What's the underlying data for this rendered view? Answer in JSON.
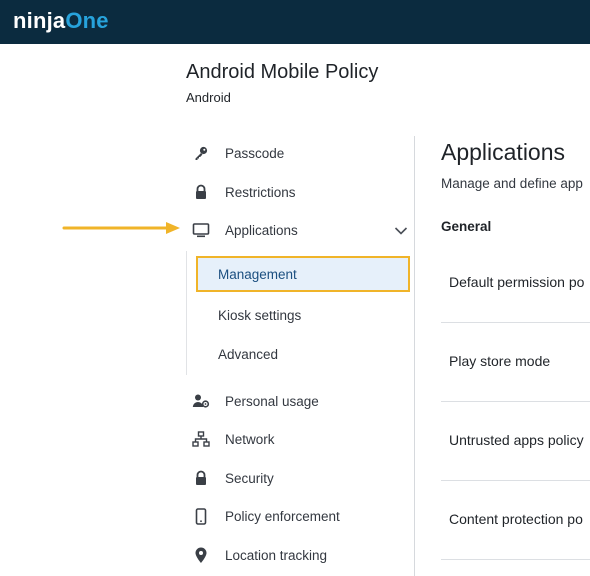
{
  "brand": {
    "logo_part1": "ninja",
    "logo_part2": "One"
  },
  "policy": {
    "title": "Android Mobile Policy",
    "subtitle": "Android"
  },
  "nav": {
    "items": [
      {
        "label": "Passcode",
        "icon": "key-icon"
      },
      {
        "label": "Restrictions",
        "icon": "lock-icon"
      },
      {
        "label": "Applications",
        "icon": "monitor-icon",
        "expanded": true
      },
      {
        "label": "Personal usage",
        "icon": "user-gear-icon"
      },
      {
        "label": "Network",
        "icon": "network-icon"
      },
      {
        "label": "Security",
        "icon": "lock-icon"
      },
      {
        "label": "Policy enforcement",
        "icon": "phone-icon"
      },
      {
        "label": "Location tracking",
        "icon": "location-pin-icon"
      }
    ],
    "subitems": [
      {
        "label": "Management",
        "active": true
      },
      {
        "label": "Kiosk settings"
      },
      {
        "label": "Advanced"
      }
    ]
  },
  "content": {
    "title": "Applications",
    "description": "Manage and define app",
    "section": "General",
    "settings": [
      "Default permission po",
      "Play store mode",
      "Untrusted apps policy",
      "Content protection po"
    ]
  },
  "colors": {
    "topbar": "#0b2b3f",
    "brand_accent": "#27a3dc",
    "highlight": "#f0b429",
    "active_bg": "#e6f0fa",
    "active_text": "#1b4f80"
  }
}
